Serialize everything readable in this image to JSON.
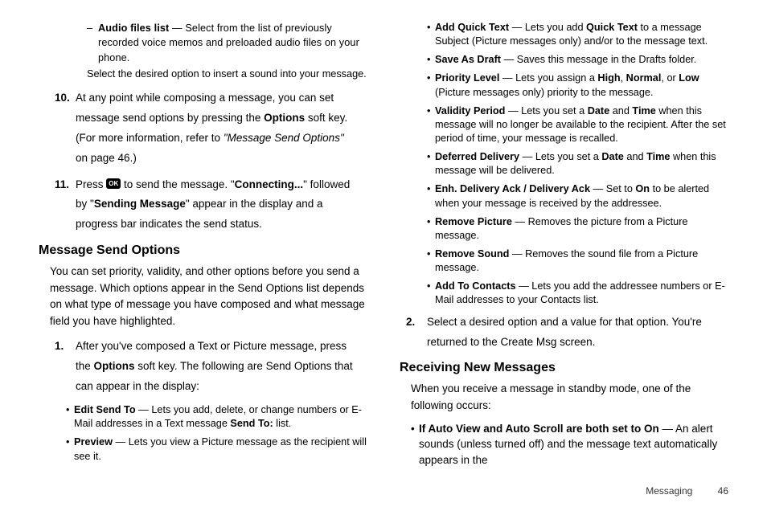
{
  "left": {
    "audio_dash": {
      "pre": "Audio files list",
      "rest": " — Select from the list of previously recorded voice memos and preloaded audio files on your phone."
    },
    "audio_note": "Select the desired option to insert a sound into your message.",
    "step10": {
      "n": "10.",
      "l1": "At any point while composing a message, you can set ",
      "l2a": "message send options by pressing the ",
      "l2b": "Options",
      "l2c": " soft key. ",
      "l3a": "(For more information, refer to ",
      "l3b": "\"Message Send Options\"",
      "l3c": " ",
      "l4": "on page 46.)"
    },
    "step11": {
      "n": "11.",
      "a": "Press ",
      "ok": "OK",
      "b": " to send the message. \"",
      "c": "Connecting...",
      "d": "\" followed ",
      "e": "by \"",
      "f": "Sending Message",
      "g": "\" appear in the display and a ",
      "h": "progress bar indicates the send status."
    },
    "h2": "Message Send Options",
    "intro": "You can set priority, validity, and other options before you send a message. Which options appear in the Send Options list depends on what type of message you have composed and what message field you have highlighted.",
    "step1": {
      "n": "1.",
      "a": "After you've composed a Text or Picture message, press ",
      "b": "the ",
      "c": "Options",
      "d": " soft key. The following are Send Options that ",
      "e": "can appear in the display:"
    },
    "b_edit": {
      "t": "Edit Send To",
      "r1": " — Lets you add, delete, or change numbers or E-Mail addresses in a Text message ",
      "r2": "Send To:",
      "r3": " list."
    },
    "b_preview": {
      "t": "Preview",
      "r": " — Lets you view a Picture message as the recipient will see it."
    }
  },
  "right": {
    "b_addquick": {
      "t": "Add Quick Text",
      "a": " — Lets you add ",
      "b": "Quick Text",
      "c": " to a message Subject (Picture messages only) and/or to the message text."
    },
    "b_save": {
      "t": "Save As Draft",
      "r": " — Saves this message in the Drafts folder."
    },
    "b_priority": {
      "t": "Priority Level",
      "a": " — Lets you assign a ",
      "b": "High",
      "c": ", ",
      "d": "Normal",
      "e": ", or ",
      "f": "Low",
      "g": " (Picture messages only) priority to the message."
    },
    "b_validity": {
      "t": "Validity Period",
      "a": " — Lets you set a ",
      "b": "Date",
      "c": " and ",
      "d": "Time",
      "e": " when this message will no longer be available to the recipient. After the set period of time, your message is recalled."
    },
    "b_deferred": {
      "t": "Deferred Delivery",
      "a": " — Lets you set a ",
      "b": "Date",
      "c": " and ",
      "d": "Time",
      "e": " when this message will be delivered."
    },
    "b_enh": {
      "t": "Enh. Delivery Ack / Delivery Ack",
      "a": " — Set to ",
      "b": "On",
      "c": " to be alerted when your message is received by the addressee."
    },
    "b_rempic": {
      "t": "Remove Picture",
      "r": " — Removes the picture from a Picture message."
    },
    "b_remsnd": {
      "t": "Remove Sound",
      "r": " — Removes the sound file from a Picture message."
    },
    "b_addcon": {
      "t": "Add To Contacts",
      "r": " — Lets you add the addressee numbers or E-Mail addresses to your Contacts list."
    },
    "step2": {
      "n": "2.",
      "t": "Select a desired option and a value for that option. You're returned to the Create Msg screen."
    },
    "h2": "Receiving New Messages",
    "intro": "When you receive a message in standby mode, one of the following occurs:",
    "b_auto": {
      "t": "If Auto View and Auto Scroll are both set to On",
      "r": " — An alert sounds (unless turned off) and the message text automatically appears in the "
    }
  },
  "footer": {
    "section": "Messaging",
    "page": "46"
  }
}
